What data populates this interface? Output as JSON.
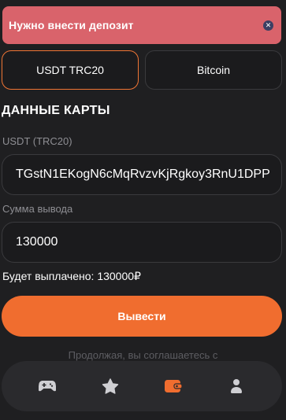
{
  "toast": {
    "message": "Нужно внести депозит",
    "close_icon": "close-icon"
  },
  "methods": [
    {
      "label": "USDT TRC20",
      "active": true
    },
    {
      "label": "Bitcoin",
      "active": false
    }
  ],
  "card_section": {
    "title": "ДАННЫЕ КАРТЫ",
    "address_label": "USDT (TRC20)",
    "address_value": "TGstN1EKogN6cMqRvzvKjRgkoy3RnU1DPP",
    "amount_label": "Сумма вывода",
    "amount_value": "130000"
  },
  "payout_text": "Будет выплачено: 130000₽",
  "withdraw_label": "Вывести",
  "agree_text": "Продолжая, вы соглашаетесь с",
  "nav": [
    {
      "icon": "gamepad-icon",
      "active": false
    },
    {
      "icon": "star-icon",
      "active": false
    },
    {
      "icon": "wallet-icon",
      "active": true
    },
    {
      "icon": "user-icon",
      "active": false
    }
  ],
  "colors": {
    "accent": "#f06d2f",
    "toast": "#d9636b",
    "background": "#1f1f21"
  }
}
